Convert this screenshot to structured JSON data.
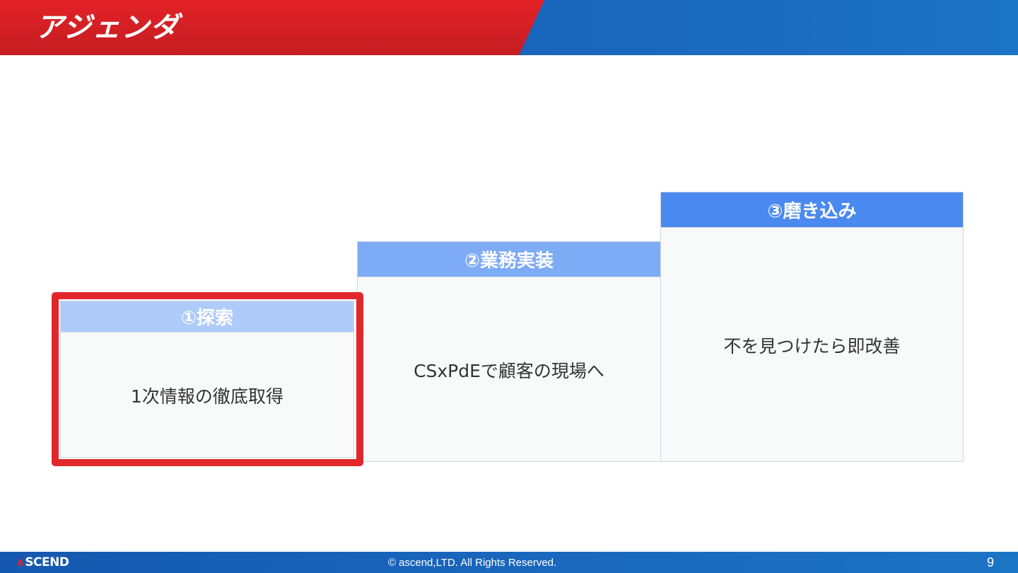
{
  "header": {
    "title": "アジェンダ"
  },
  "steps": [
    {
      "title": "①探索",
      "body": "1次情報の徹底取得",
      "color": "#aecbf9"
    },
    {
      "title": "②業務実装",
      "body": "CSxPdEで顧客の現場へ",
      "color": "#7eabf5"
    },
    {
      "title": "③磨き込み",
      "body": "不を見つけたら即改善",
      "color": "#4a89f0"
    }
  ],
  "highlight_color": "#e1272b",
  "footer": {
    "logo_mark": "∧",
    "logo_text": "SCEND",
    "copyright": "©  ascend,LTD. All Rights Reserved.",
    "page_number": "9"
  }
}
